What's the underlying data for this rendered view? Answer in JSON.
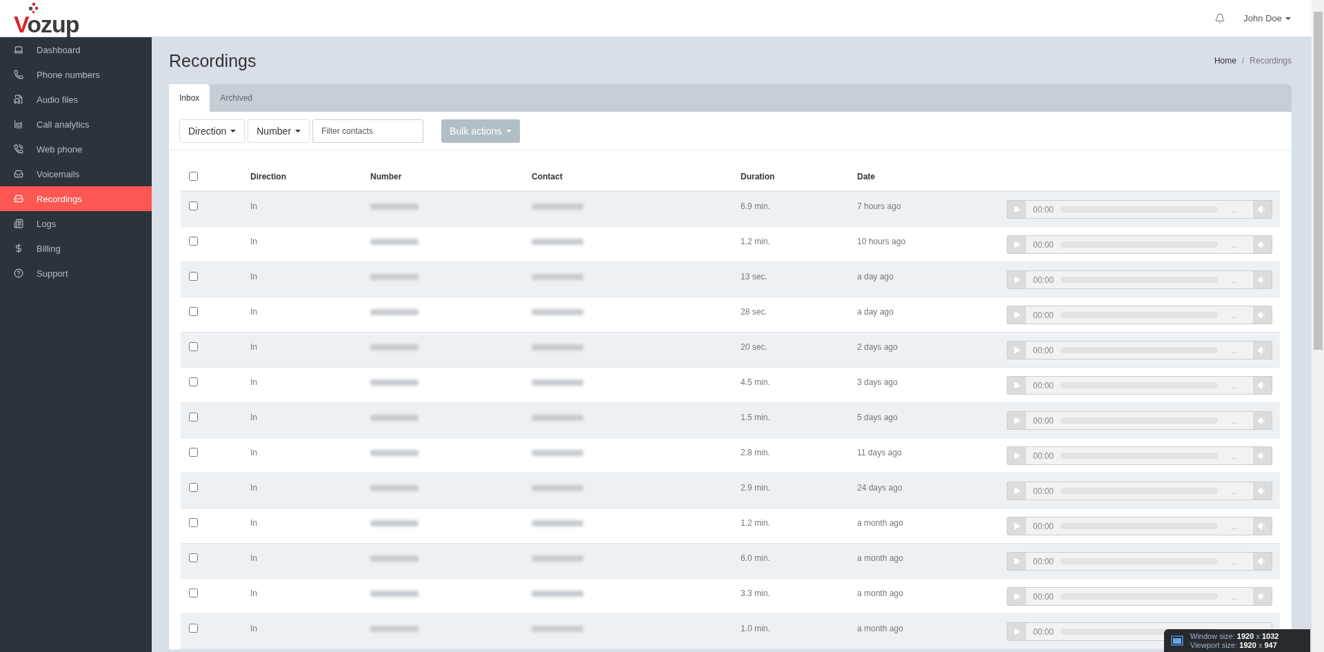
{
  "logo": "Vozup",
  "header": {
    "user": "John Doe"
  },
  "sidebar": {
    "items": [
      {
        "label": "Dashboard",
        "selected": false
      },
      {
        "label": "Phone numbers",
        "selected": false
      },
      {
        "label": "Audio files",
        "selected": false
      },
      {
        "label": "Call analytics",
        "selected": false
      },
      {
        "label": "Web phone",
        "selected": false
      },
      {
        "label": "Voicemails",
        "selected": false
      },
      {
        "label": "Recordings",
        "selected": true
      },
      {
        "label": "Logs",
        "selected": false
      },
      {
        "label": "Billing",
        "selected": false
      },
      {
        "label": "Support",
        "selected": false
      }
    ]
  },
  "page": {
    "title": "Recordings",
    "breadcrumb": {
      "items": [
        "Home",
        "Recordings"
      ],
      "separator": "/"
    }
  },
  "tabs": [
    {
      "label": "Inbox",
      "selected": true
    },
    {
      "label": "Archived",
      "selected": false
    }
  ],
  "toolbar": {
    "filters": [
      "Direction",
      "Number"
    ],
    "search": {
      "placeholder": "Filter contacts"
    },
    "bulk": {
      "label": "Bulk actions",
      "disabled": true
    }
  },
  "table": {
    "select_all": {
      "checked": false
    },
    "columns": [
      "Direction",
      "Number",
      "Contact",
      "Duration",
      "Date"
    ],
    "rows": [
      {
        "checked": false,
        "direction": "In",
        "duration": "6.9 min.",
        "date": "7 hours ago",
        "player": {
          "time": "00:00",
          "length": "..."
        }
      },
      {
        "checked": false,
        "direction": "In",
        "duration": "1.2 min.",
        "date": "10 hours ago",
        "player": {
          "time": "00:00",
          "length": "..."
        }
      },
      {
        "checked": false,
        "direction": "In",
        "duration": "13 sec.",
        "date": "a day ago",
        "player": {
          "time": "00:00",
          "length": "..."
        }
      },
      {
        "checked": false,
        "direction": "In",
        "duration": "28 sec.",
        "date": "a day ago",
        "player": {
          "time": "00:00",
          "length": "..."
        }
      },
      {
        "checked": false,
        "direction": "In",
        "duration": "20 sec.",
        "date": "2 days ago",
        "player": {
          "time": "00:00",
          "length": "..."
        }
      },
      {
        "checked": false,
        "direction": "In",
        "duration": "4.5 min.",
        "date": "3 days ago",
        "player": {
          "time": "00:00",
          "length": "..."
        }
      },
      {
        "checked": false,
        "direction": "In",
        "duration": "1.5 min.",
        "date": "5 days ago",
        "player": {
          "time": "00:00",
          "length": "..."
        }
      },
      {
        "checked": false,
        "direction": "In",
        "duration": "2.8 min.",
        "date": "11 days ago",
        "player": {
          "time": "00:00",
          "length": "..."
        }
      },
      {
        "checked": false,
        "direction": "In",
        "duration": "2.9 min.",
        "date": "24 days ago",
        "player": {
          "time": "00:00",
          "length": "..."
        }
      },
      {
        "checked": false,
        "direction": "In",
        "duration": "1.2 min.",
        "date": "a month ago",
        "player": {
          "time": "00:00",
          "length": "..."
        }
      },
      {
        "checked": false,
        "direction": "In",
        "duration": "6.0 min.",
        "date": "a month ago",
        "player": {
          "time": "00:00",
          "length": "..."
        }
      },
      {
        "checked": false,
        "direction": "In",
        "duration": "3.3 min.",
        "date": "a month ago",
        "player": {
          "time": "00:00",
          "length": "..."
        }
      },
      {
        "checked": false,
        "direction": "In",
        "duration": "1.0 min.",
        "date": "a month ago",
        "player": {
          "time": "00:00"
        }
      }
    ]
  },
  "size_overlay": {
    "window_label": "Window size:",
    "window_w": "1920",
    "window_h": "1032",
    "window_times": "x",
    "viewport_label": "Viewport size:",
    "viewport_w": "1920",
    "viewport_times": "x",
    "viewport_h": "947"
  }
}
